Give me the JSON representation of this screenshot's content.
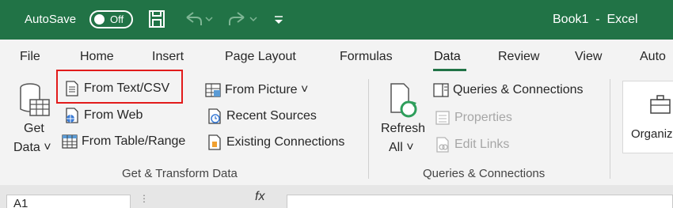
{
  "titlebar": {
    "autosave_label": "AutoSave",
    "autosave_state": "Off",
    "book_title": "Book1  -  Excel",
    "icons": [
      "save-icon",
      "undo-icon",
      "redo-icon",
      "customize-quick-access-icon"
    ]
  },
  "tabs": [
    "File",
    "Home",
    "Insert",
    "Page Layout",
    "Formulas",
    "Data",
    "Review",
    "View",
    "Auto"
  ],
  "active_tab": "Data",
  "ribbon": {
    "get_data": {
      "line1": "Get",
      "line2": "Data ˅"
    },
    "get_transform": {
      "from_text_csv": "From Text/CSV",
      "from_web": "From Web",
      "from_table_range": "From Table/Range",
      "from_picture": "From Picture ˅",
      "recent_sources": "Recent Sources",
      "existing_connections": "Existing Connections",
      "group_label": "Get & Transform Data"
    },
    "refresh_all": {
      "line1": "Refresh",
      "line2": "All ˅"
    },
    "queries": {
      "queries_connections": "Queries & Connections",
      "properties": "Properties",
      "edit_links": "Edit Links",
      "group_label": "Queries & Connections"
    },
    "organize_label": "Organiz"
  },
  "formula_bar": {
    "namebox": "A1",
    "fx": "fx"
  },
  "colors": {
    "title_bg": "#217346",
    "highlight": "#e21b1b"
  }
}
